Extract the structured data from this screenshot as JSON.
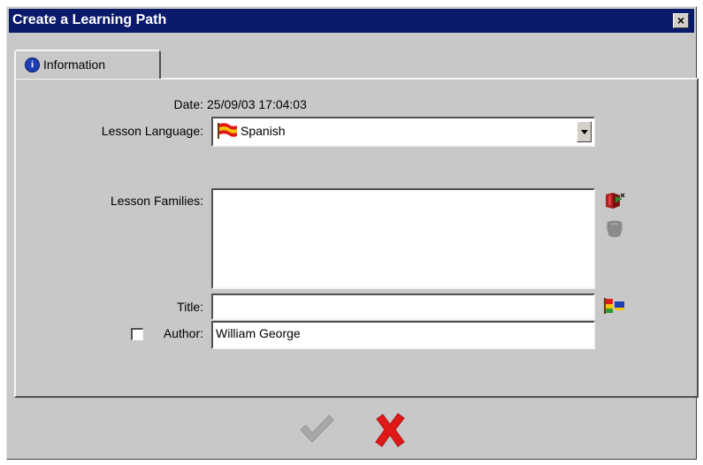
{
  "window": {
    "title": "Create a Learning Path",
    "close_glyph": "×"
  },
  "tab": {
    "label": "Information",
    "icon": "info-icon"
  },
  "form": {
    "date_label": "Date:",
    "date_value": "25/09/03 17:04:03",
    "language_label": "Lesson Language:",
    "language_value": "Spanish",
    "language_icon": "spanish-flag-icon",
    "families_label": "Lesson Families:",
    "title_label": "Title:",
    "title_value": "",
    "author_label": "Author:",
    "author_value": "William George",
    "author_checked": false
  },
  "side_icons": {
    "families_add": "add-family-icon",
    "families_remove": "remove-family-icon",
    "title_edit": "edit-title-icon"
  },
  "buttons": {
    "ok_icon": "checkmark-icon",
    "cancel_icon": "cross-icon"
  },
  "colors": {
    "titlebar": "#0a1a6b",
    "dialog": "#c8c8c8",
    "ok_disabled": "#a8a8a8",
    "cancel": "#e01818"
  }
}
